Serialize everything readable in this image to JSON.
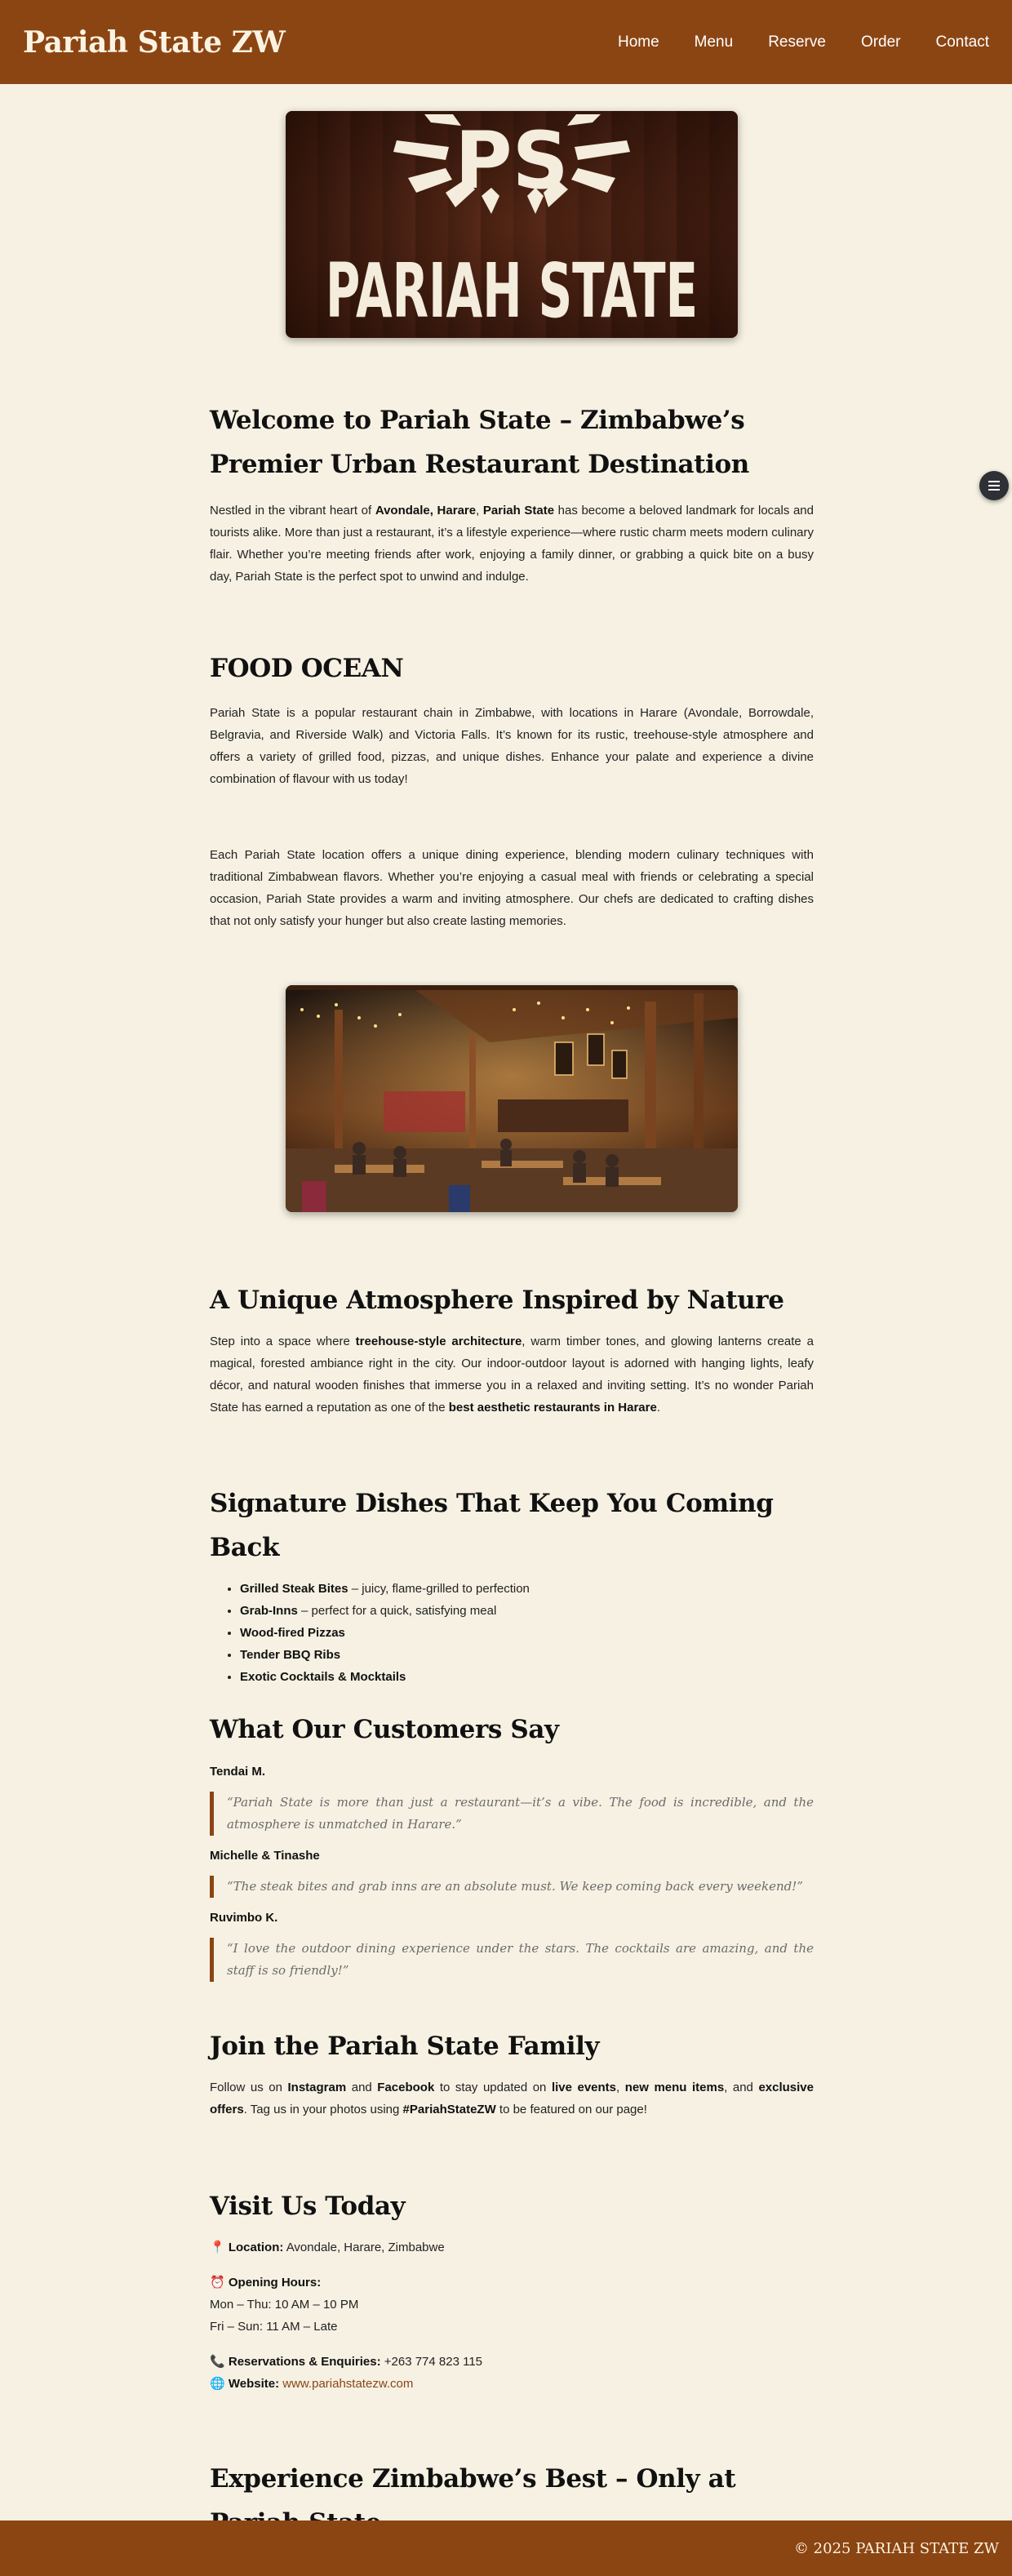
{
  "header": {
    "brand": "Pariah State ZW",
    "nav": [
      "Home",
      "Menu",
      "Reserve",
      "Order",
      "Contact"
    ]
  },
  "hero_logo": {
    "monogram": "PS",
    "wordmark": "PARIAH STATE"
  },
  "welcome": {
    "title": "Welcome to Pariah State – Zimbabwe’s Premier Urban Restaurant Destination",
    "p_pre": "Nestled in the vibrant heart of ",
    "p_bold1": "Avondale, Harare",
    "p_mid": ", ",
    "p_bold2": "Pariah State",
    "p_post": " has become a beloved landmark for locals and tourists alike. More than just a restaurant, it’s a lifestyle experience—where rustic charm meets modern culinary flair. Whether you’re meeting friends after work, enjoying a family dinner, or grabbing a quick bite on a busy day, Pariah State is the perfect spot to unwind and indulge."
  },
  "food_ocean": {
    "title": "FOOD OCEAN",
    "p1": "Pariah State is a popular restaurant chain in Zimbabwe, with locations in Harare (Avondale, Borrowdale, Belgravia, and Riverside Walk) and Victoria Falls. It’s known for its rustic, treehouse-style atmosphere and offers a variety of grilled food, pizzas, and unique dishes. Enhance your palate and experience a divine combination of flavour with us today!",
    "p2": "Each Pariah State location offers a unique dining experience, blending modern culinary techniques with traditional Zimbabwean flavors. Whether you’re enjoying a casual meal with friends or celebrating a special occasion, Pariah State provides a warm and inviting atmosphere. Our chefs are dedicated to crafting dishes that not only satisfy your hunger but also create lasting memories."
  },
  "atmosphere": {
    "title": "A Unique Atmosphere Inspired by Nature",
    "p_pre": "Step into a space where ",
    "p_bold1": "treehouse-style architecture",
    "p_mid": ", warm timber tones, and glowing lanterns create a magical, forested ambiance right in the city. Our indoor-outdoor layout is adorned with hanging lights, leafy décor, and natural wooden finishes that immerse you in a relaxed and inviting setting. It’s no wonder Pariah State has earned a reputation as one of the ",
    "p_bold2": "best aesthetic restaurants in Harare",
    "p_post": "."
  },
  "dishes": {
    "title": "Signature Dishes That Keep You Coming Back",
    "items": [
      {
        "name": "Grilled Steak Bites",
        "desc": " – juicy, flame-grilled to perfection"
      },
      {
        "name": "Grab-Inns",
        "desc": " – perfect for a quick, satisfying meal"
      },
      {
        "name": "Wood-fired Pizzas",
        "desc": ""
      },
      {
        "name": "Tender BBQ Ribs",
        "desc": ""
      },
      {
        "name": "Exotic Cocktails & Mocktails",
        "desc": ""
      }
    ]
  },
  "reviews": {
    "title": "What Our Customers Say",
    "items": [
      {
        "name": "Tendai M.",
        "quote": "“Pariah State is more than just a restaurant—it’s a vibe. The food is incredible, and the atmosphere is unmatched in Harare.”"
      },
      {
        "name": "Michelle & Tinashe",
        "quote": "“The steak bites and grab inns are an absolute must. We keep coming back every weekend!”"
      },
      {
        "name": "Ruvimbo K.",
        "quote": "“I love the outdoor dining experience under the stars. The cocktails are amazing, and the staff is so friendly!”"
      }
    ]
  },
  "join": {
    "title": "Join the Pariah State Family",
    "t1": "Follow us on ",
    "b1": "Instagram",
    "t2": " and ",
    "b2": "Facebook",
    "t3": " to stay updated on ",
    "b3": "live events",
    "t4": ", ",
    "b4": "new menu items",
    "t5": ", and ",
    "b5": "exclusive offers",
    "t6": ". Tag us in your photos using ",
    "b6": "#PariahStateZW",
    "t7": " to be featured on our page!"
  },
  "visit": {
    "title": "Visit Us Today",
    "location_icon": "📍",
    "location_label": "Location:",
    "location_value": " Avondale, Harare, Zimbabwe",
    "hours_icon": "⏰",
    "hours_label": "Opening Hours:",
    "hours_1": "Mon – Thu: 10 AM – 10 PM",
    "hours_2": "Fri – Sun: 11 AM – Late",
    "phone_icon": "📞",
    "phone_label": "Reservations & Enquiries:",
    "phone_value": " +263 774 823 115",
    "web_icon": "🌐",
    "web_label": "Website:",
    "web_value": "www.pariahstatezw.com"
  },
  "closing": {
    "title": "Experience Zimbabwe’s Best – Only at Pariah State"
  },
  "footer": {
    "copyright": "© 2025 PARIAH STATE ZW"
  },
  "colors": {
    "brand": "#8b4513",
    "background": "#f6f1e3",
    "text": "#222222"
  },
  "icons": {
    "widget": "menu-icon"
  }
}
